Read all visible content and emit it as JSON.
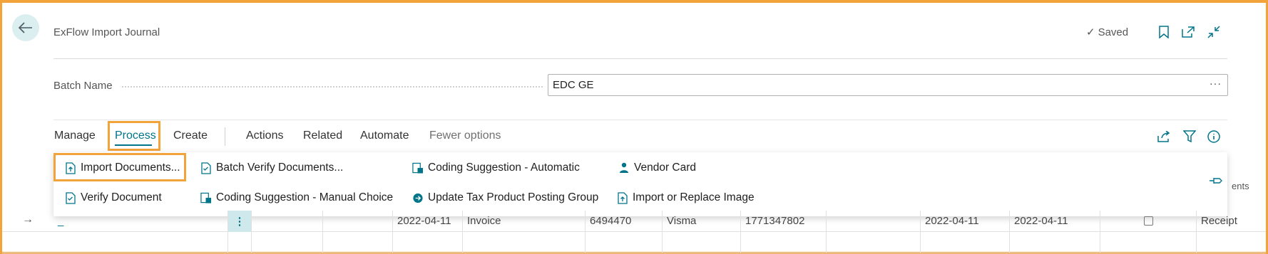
{
  "header": {
    "title": "ExFlow Import Journal",
    "saved_label": "Saved"
  },
  "batch": {
    "label": "Batch Name",
    "value": "EDC GE",
    "more": "···"
  },
  "actionbar": {
    "tabs": [
      "Manage",
      "Process",
      "Create",
      "Actions",
      "Related",
      "Automate"
    ],
    "fewer_options": "Fewer options"
  },
  "menu": {
    "row1": [
      "Import Documents...",
      "Batch Verify Documents...",
      "Coding Suggestion - Automatic",
      "Vendor Card"
    ],
    "row2": [
      "Verify Document",
      "Coding Suggestion - Manual Choice",
      "Update Tax Product Posting Group",
      "Import or Replace Image"
    ]
  },
  "behind_text": "ents",
  "grid": {
    "row1": {
      "col1": "_",
      "dots": "⋮",
      "doc_date": "2022-04-11",
      "doc_type": "Invoice",
      "number": "6494470",
      "vendor": "Visma",
      "id": "1771347802",
      "date2": "2022-04-11",
      "date3": "2022-04-11",
      "last": "Receipt"
    }
  }
}
